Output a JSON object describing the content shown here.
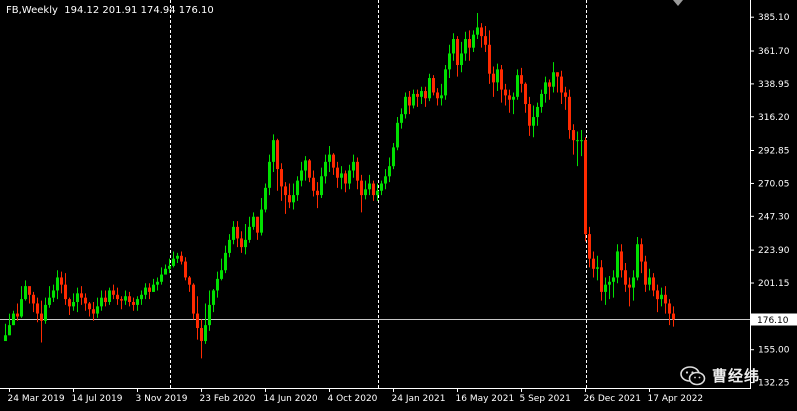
{
  "chart_header": {
    "symbol": "FB,Weekly",
    "ohlc": "194.12 201.91 174.94 176.10"
  },
  "watermark": {
    "text": "曹经纬",
    "icon": "wechat-icon"
  },
  "colors": {
    "background": "#000000",
    "bull": "#00e000",
    "bear": "#ff2a00",
    "axis": "#ffffff",
    "price_line": "#c8c8c8",
    "separator": "#ffffff",
    "price_label_bg": "#ffffff",
    "price_label_text": "#000000"
  },
  "chart_data": {
    "type": "candlestick",
    "symbol": "FB",
    "timeframe": "Weekly",
    "y_ticks": [
      "385.10",
      "361.70",
      "338.95",
      "316.20",
      "292.85",
      "270.05",
      "247.30",
      "223.90",
      "201.15",
      "155.00",
      "132.25"
    ],
    "ylim": [
      128.5,
      397.0
    ],
    "current_price": "176.10",
    "x_ticks": [
      "24 Mar 2019",
      "14 Jul 2019",
      "3 Nov 2019",
      "23 Feb 2020",
      "14 Jun 2020",
      "4 Oct 2020",
      "24 Jan 2021",
      "16 May 2021",
      "5 Sep 2021",
      "26 Dec 2021",
      "17 Apr 2022"
    ],
    "x_tick_bars": [
      1,
      17,
      33,
      49,
      65,
      81,
      97,
      113,
      129,
      145,
      161
    ],
    "separator_bars": [
      41,
      93,
      145
    ],
    "closes": [
      165,
      172,
      180,
      178,
      190,
      199,
      193,
      187,
      180,
      175,
      186,
      191,
      196,
      205,
      200,
      190,
      185,
      188,
      194,
      191,
      187,
      183,
      180,
      185,
      191,
      188,
      196,
      193,
      190,
      189,
      192,
      188,
      186,
      190,
      193,
      198,
      195,
      200,
      202,
      207,
      211,
      213,
      218,
      220,
      216,
      205,
      200,
      180,
      170,
      161,
      172,
      186,
      196,
      204,
      210,
      222,
      231,
      240,
      232,
      226,
      231,
      240,
      247,
      236,
      252,
      267,
      285,
      300,
      280,
      268,
      262,
      257,
      262,
      272,
      279,
      286,
      274,
      265,
      262,
      275,
      285,
      290,
      281,
      274,
      277,
      270,
      279,
      285,
      272,
      262,
      266,
      270,
      262,
      265,
      270,
      275,
      282,
      295,
      312,
      318,
      330,
      324,
      332,
      330,
      334,
      329,
      343,
      333,
      329,
      331,
      349,
      360,
      370,
      352,
      360,
      370,
      364,
      373,
      378,
      372,
      366,
      346,
      340,
      349,
      335,
      331,
      328,
      330,
      345,
      339,
      325,
      310,
      316,
      323,
      332,
      340,
      337,
      347,
      344,
      333,
      330,
      307,
      300,
      300,
      300,
      235,
      218,
      211,
      212,
      195,
      200,
      202,
      205,
      223,
      210,
      200,
      198,
      205,
      228,
      216,
      200,
      205,
      196,
      190,
      193,
      187,
      180,
      176
    ],
    "highs": [
      173,
      180,
      182,
      187,
      199,
      203,
      198,
      195,
      191,
      189,
      191,
      199,
      200,
      210,
      209,
      208,
      191,
      194,
      198,
      199,
      194,
      188,
      188,
      191,
      196,
      196,
      198,
      200,
      198,
      192,
      196,
      195,
      191,
      192,
      196,
      201,
      201,
      204,
      205,
      212,
      214,
      218,
      223,
      222,
      223,
      219,
      206,
      201,
      192,
      176,
      187,
      196,
      197,
      209,
      218,
      227,
      235,
      244,
      244,
      237,
      242,
      247,
      250,
      247,
      260,
      270,
      290,
      304,
      301,
      284,
      271,
      270,
      270,
      275,
      285,
      289,
      287,
      279,
      271,
      281,
      290,
      296,
      291,
      285,
      282,
      279,
      283,
      290,
      288,
      276,
      272,
      276,
      272,
      270,
      272,
      280,
      288,
      298,
      316,
      322,
      333,
      334,
      335,
      335,
      337,
      337,
      346,
      345,
      336,
      339,
      352,
      366,
      374,
      372,
      368,
      375,
      376,
      376,
      388,
      381,
      379,
      376,
      351,
      353,
      352,
      339,
      335,
      333,
      349,
      350,
      340,
      330,
      324,
      326,
      335,
      344,
      342,
      354,
      347,
      348,
      337,
      335,
      311,
      306,
      307,
      302,
      240,
      223,
      220,
      217,
      205,
      206,
      210,
      228,
      228,
      215,
      205,
      210,
      233,
      232,
      220,
      211,
      208,
      200,
      198,
      199,
      190,
      185
    ],
    "lows": [
      161,
      165,
      172,
      175,
      177,
      189,
      187,
      181,
      174,
      160,
      173,
      184,
      188,
      190,
      194,
      186,
      179,
      182,
      181,
      186,
      182,
      178,
      175,
      177,
      182,
      185,
      186,
      190,
      186,
      183,
      186,
      185,
      182,
      182,
      186,
      190,
      190,
      195,
      196,
      200,
      207,
      208,
      212,
      215,
      214,
      203,
      195,
      176,
      162,
      149,
      159,
      168,
      181,
      191,
      203,
      208,
      219,
      228,
      226,
      222,
      221,
      229,
      238,
      231,
      234,
      250,
      262,
      278,
      265,
      258,
      249,
      253,
      252,
      258,
      268,
      272,
      271,
      261,
      253,
      260,
      270,
      278,
      276,
      267,
      266,
      264,
      266,
      274,
      266,
      250,
      259,
      262,
      258,
      258,
      262,
      266,
      271,
      280,
      293,
      308,
      315,
      318,
      322,
      323,
      325,
      323,
      327,
      331,
      324,
      324,
      328,
      343,
      355,
      344,
      347,
      355,
      355,
      361,
      370,
      364,
      361,
      339,
      330,
      334,
      326,
      324,
      319,
      318,
      328,
      333,
      319,
      303,
      302,
      310,
      319,
      326,
      328,
      333,
      333,
      325,
      321,
      301,
      290,
      282,
      289,
      230,
      212,
      205,
      203,
      189,
      186,
      190,
      191,
      201,
      205,
      195,
      185,
      189,
      203,
      208,
      195,
      196,
      192,
      181,
      185,
      180,
      172,
      171
    ]
  }
}
